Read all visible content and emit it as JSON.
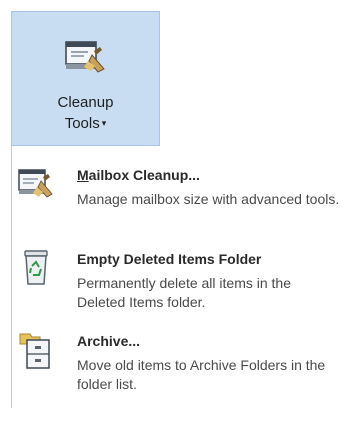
{
  "ribbon_button": {
    "label_line1": "Cleanup",
    "label_line2": "Tools",
    "arrow": "▾",
    "icon": "mailbox-cleanup-icon"
  },
  "menu": {
    "items": [
      {
        "accel_char": "M",
        "title_rest": "ailbox Cleanup...",
        "description": "Manage mailbox size with advanced tools.",
        "icon": "mailbox-cleanup-icon"
      },
      {
        "accel_char": "",
        "title_rest": "Empty Deleted Items Folder",
        "description": "Permanently delete all items in the Deleted Items folder.",
        "icon": "recycle-bin-icon"
      },
      {
        "accel_char": "",
        "title_rest": "Archive...",
        "description": "Move old items to Archive Folders in the folder list.",
        "icon": "archive-icon"
      }
    ]
  },
  "colors": {
    "ribbon_selected_bg": "#c9ddf2",
    "ribbon_selected_border": "#a9c6e6",
    "menu_border": "#c8c8c8"
  }
}
